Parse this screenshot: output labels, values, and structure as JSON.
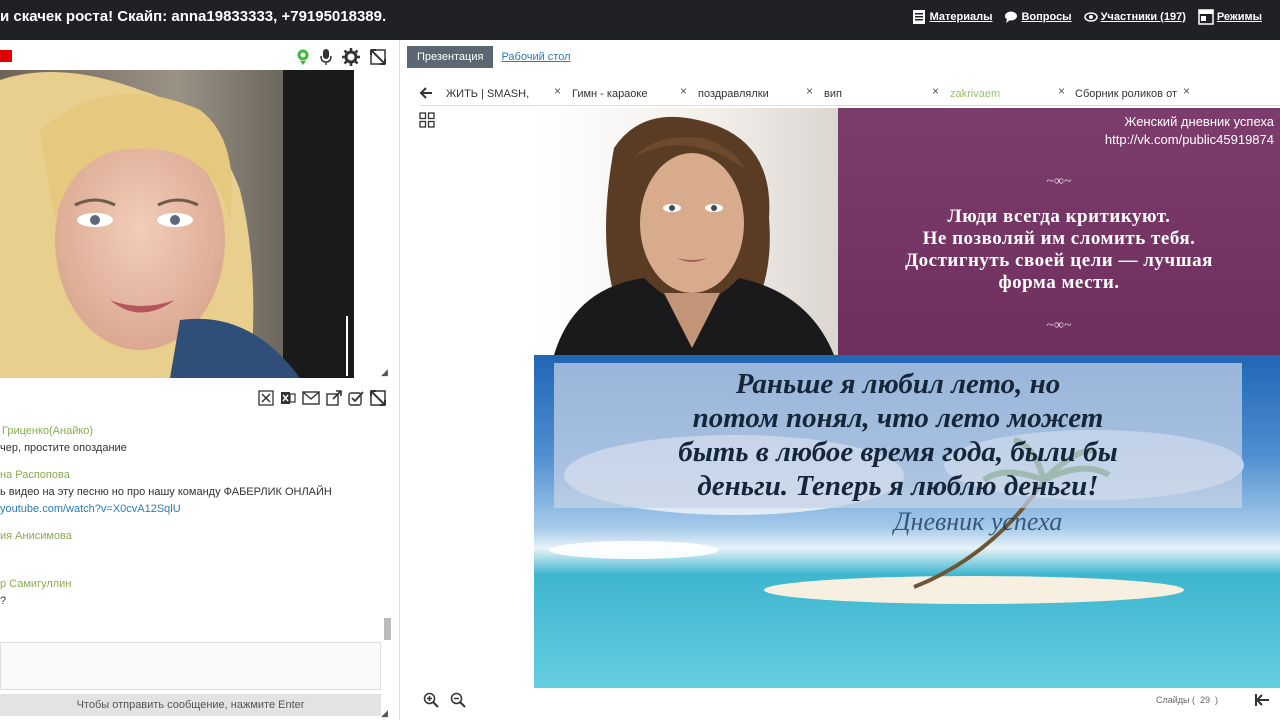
{
  "header": {
    "title": "и скачек роста! Скайп: anna19833333, +79195018389.",
    "nav": [
      {
        "label": "Материалы",
        "icon": "documents-icon"
      },
      {
        "label": "Вопросы",
        "icon": "speech-bubble-icon"
      },
      {
        "label": "Участники (197)",
        "icon": "eye-icon"
      },
      {
        "label": "Режимы",
        "icon": "window-icon"
      }
    ]
  },
  "chat": {
    "messages": [
      {
        "author": "Гриценко(Анайко)",
        "lines": [
          "чер, простите опоздание"
        ],
        "link": ""
      },
      {
        "author": "на Распопова",
        "lines": [
          "ь видео на эту песню но про нашу команду ФАБЕРЛИК ОНЛАЙН"
        ],
        "link": "youtube.com/watch?v=X0cvA12SqlU"
      },
      {
        "author": "ия Анисимова",
        "lines": [],
        "link": ""
      },
      {
        "author": "р Самигуллин",
        "lines": [
          "?"
        ],
        "link": ""
      }
    ],
    "hint": "Чтобы отправить сообщение, нажмите Enter"
  },
  "presentation": {
    "tabs": [
      {
        "label": "Презентация",
        "active": true
      },
      {
        "label": "Рабочий стол",
        "active": false
      }
    ],
    "slide_tabs": [
      {
        "label": "ЖИТЬ | SMASH,",
        "color": "#333333"
      },
      {
        "label": "Гимн - караоке",
        "color": "#333333"
      },
      {
        "label": "поздравлялки",
        "color": "#333333"
      },
      {
        "label": "вип",
        "color": "#333333"
      },
      {
        "label": "zakrivaem",
        "color": "#9bbf6a"
      },
      {
        "label": "Сборник роликов от",
        "color": "#333333"
      }
    ],
    "slide": {
      "site_name": "Женский дневник успеха",
      "site_url": "http://vk.com/public45919874",
      "ornament": "~∞~",
      "quote_top": [
        "Люди всегда критикуют.",
        "Не позволяй им сломить тебя.",
        "Достигнуть своей цели — лучшая",
        "форма мести."
      ],
      "quote_bottom": [
        "Раньше я любил лето, но",
        "потом понял, что лето может",
        "быть в любое время года, были бы",
        "деньги. Теперь я люблю деньги!"
      ],
      "signature": "Дневник успеха"
    },
    "slides_label": "Слайды (",
    "slides_count": "29",
    "slides_close": ")"
  }
}
